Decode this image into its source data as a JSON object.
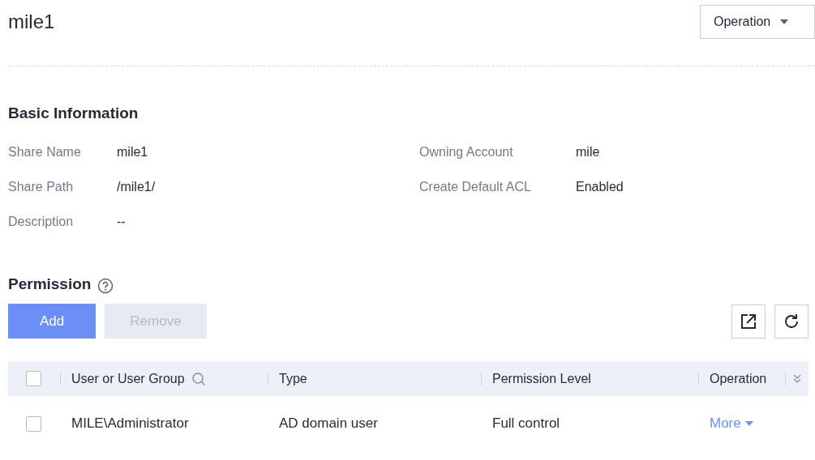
{
  "title": "mile1",
  "operation_button": {
    "label": "Operation"
  },
  "basic_information": {
    "heading": "Basic Information",
    "fields": [
      {
        "label": "Share Name",
        "value": "mile1"
      },
      {
        "label": "Owning Account",
        "value": "mile"
      },
      {
        "label": "Share Path",
        "value": "/mile1/"
      },
      {
        "label": "Create Default ACL",
        "value": "Enabled"
      },
      {
        "label": "Description",
        "value": "--"
      }
    ]
  },
  "permission": {
    "heading": "Permission",
    "buttons": [
      {
        "label": "Add",
        "disabled": false
      },
      {
        "label": "Remove",
        "disabled": true
      }
    ],
    "table": {
      "header_checked": false,
      "columns": [
        {
          "label": "User or User Group",
          "searchable": true
        },
        {
          "label": "Type",
          "searchable": false
        },
        {
          "label": "Permission Level",
          "searchable": false
        },
        {
          "label": "Operation",
          "searchable": false
        }
      ],
      "rows": [
        {
          "checked": false,
          "user": "MILE\\Administrator",
          "type": "AD domain user",
          "level": "Full control",
          "action": "More"
        }
      ]
    }
  }
}
